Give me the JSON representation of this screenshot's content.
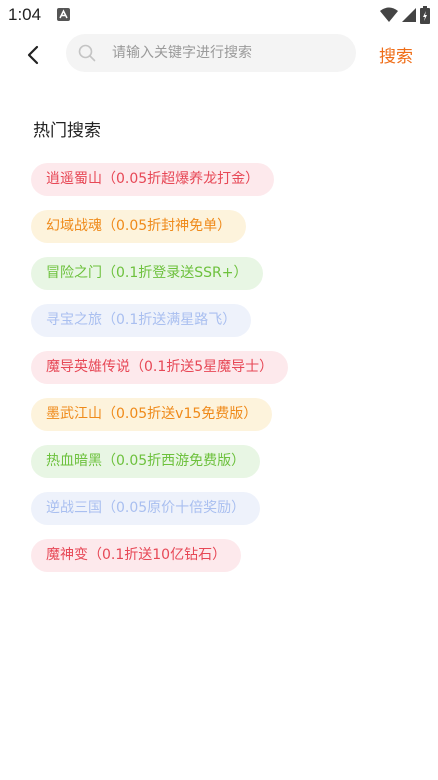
{
  "status_bar": {
    "time": "1:04",
    "notification_icon": "app-notification-icon",
    "wifi_icon": "wifi-icon",
    "signal_icon": "signal-icon",
    "battery_icon": "battery-charging-icon"
  },
  "header": {
    "back_icon": "chevron-left-icon",
    "search_icon": "search-icon",
    "search_placeholder": "请输入关键字进行搜索",
    "search_value": "",
    "search_button_label": "搜索",
    "accent_color": "#ef6d17"
  },
  "hot_search": {
    "title": "热门搜索",
    "tags": [
      {
        "label": "逍遥蜀山（0.05折超爆养龙打金）",
        "text_color": "#e74856",
        "bg_color": "#fde9ec"
      },
      {
        "label": "幻域战魂（0.05折封神免单）",
        "text_color": "#ef8a1a",
        "bg_color": "#fdf3dc"
      },
      {
        "label": "冒险之门（0.1折登录送SSR+）",
        "text_color": "#6dc13d",
        "bg_color": "#e8f6e4"
      },
      {
        "label": "寻宝之旅（0.1折送满星路飞）",
        "text_color": "#a9bff0",
        "bg_color": "#eef2fb"
      },
      {
        "label": "魔导英雄传说（0.1折送5星魔导士）",
        "text_color": "#e74856",
        "bg_color": "#fde9ec"
      },
      {
        "label": "墨武江山（0.05折送v15免费版）",
        "text_color": "#ef8a1a",
        "bg_color": "#fdf3dc"
      },
      {
        "label": "热血暗黑（0.05折西游免费版）",
        "text_color": "#6dc13d",
        "bg_color": "#e8f6e4"
      },
      {
        "label": "逆战三国（0.05原价十倍奖励）",
        "text_color": "#a9bff0",
        "bg_color": "#eef2fb"
      },
      {
        "label": "魔神变（0.1折送10亿钻石）",
        "text_color": "#e74856",
        "bg_color": "#fde9ec"
      }
    ]
  }
}
